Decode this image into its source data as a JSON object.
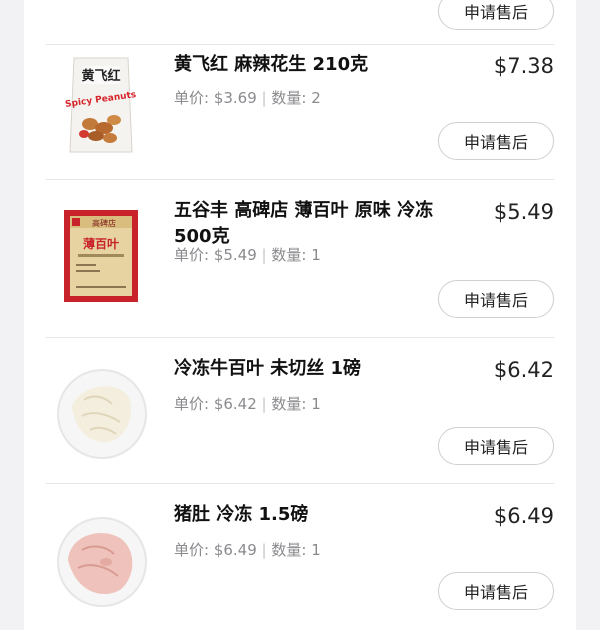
{
  "button_label": "申请售后",
  "top_item": {
    "button": "申请售后"
  },
  "items": [
    {
      "title": "黄飞红 麻辣花生 210克",
      "price": "$7.38",
      "unit_price_label": "单价: $3.69",
      "qty_label": "数量: 2",
      "button": "申请售后",
      "thumb": "spicy-peanuts-bag",
      "pkg_text": "Spicy Peanuts",
      "pkg_brand": "黄飞红"
    },
    {
      "title": "五谷丰 高碑店 薄百叶 原味 冷冻 500克",
      "price": "$5.49",
      "unit_price_label": "单价: $5.49",
      "qty_label": "数量: 1",
      "button": "申请售后",
      "thumb": "tofu-sheet-package",
      "pkg_text": "薄百叶",
      "pkg_brand": "高碑店"
    },
    {
      "title": "冷冻牛百叶 未切丝 1磅",
      "price": "$6.42",
      "unit_price_label": "单价: $6.42",
      "qty_label": "数量: 1",
      "button": "申请售后",
      "thumb": "beef-tripe-plate"
    },
    {
      "title": "猪肚 冷冻 1.5磅",
      "price": "$6.49",
      "unit_price_label": "单价: $6.49",
      "qty_label": "数量: 1",
      "button": "申请售后",
      "thumb": "pork-stomach-plate"
    }
  ],
  "colors": {
    "page_bg": "#f2f2f4",
    "card_bg": "#ffffff",
    "divider": "#e7e7ea",
    "text_primary": "#111111",
    "text_secondary": "#8a8a8e",
    "button_border": "#cfcfd3"
  }
}
